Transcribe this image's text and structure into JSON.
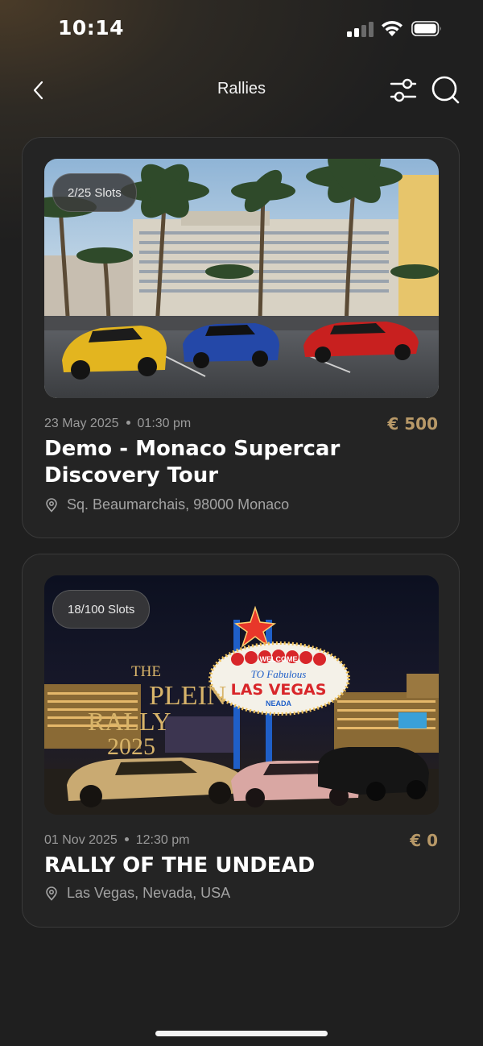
{
  "status_bar": {
    "time": "10:14"
  },
  "nav": {
    "title": "Rallies"
  },
  "rallies": [
    {
      "slots": "2/25 Slots",
      "date": "23 May 2025",
      "time": "01:30 pm",
      "price": "€ 500",
      "title": "Demo - Monaco Supercar Discovery Tour",
      "location": "Sq. Beaumarchais, 98000 Monaco"
    },
    {
      "slots": "18/100 Slots",
      "date": "01 Nov 2025",
      "time": "12:30 pm",
      "price": "€ 0",
      "title": "RALLY OF THE UNDEAD",
      "location": "Las Vegas, Nevada, USA",
      "image_text": {
        "the": "THE",
        "plein": "PLEIN",
        "rally": "RALLY",
        "year": "2025",
        "welcome": "WELCOME",
        "to_fabulous": "TO Fabulous",
        "las_vegas": "LAS VEGAS",
        "nevada": "NEADA"
      }
    }
  ],
  "colors": {
    "accent": "#b89968",
    "background": "#1f1f1f",
    "card": "#242424"
  }
}
